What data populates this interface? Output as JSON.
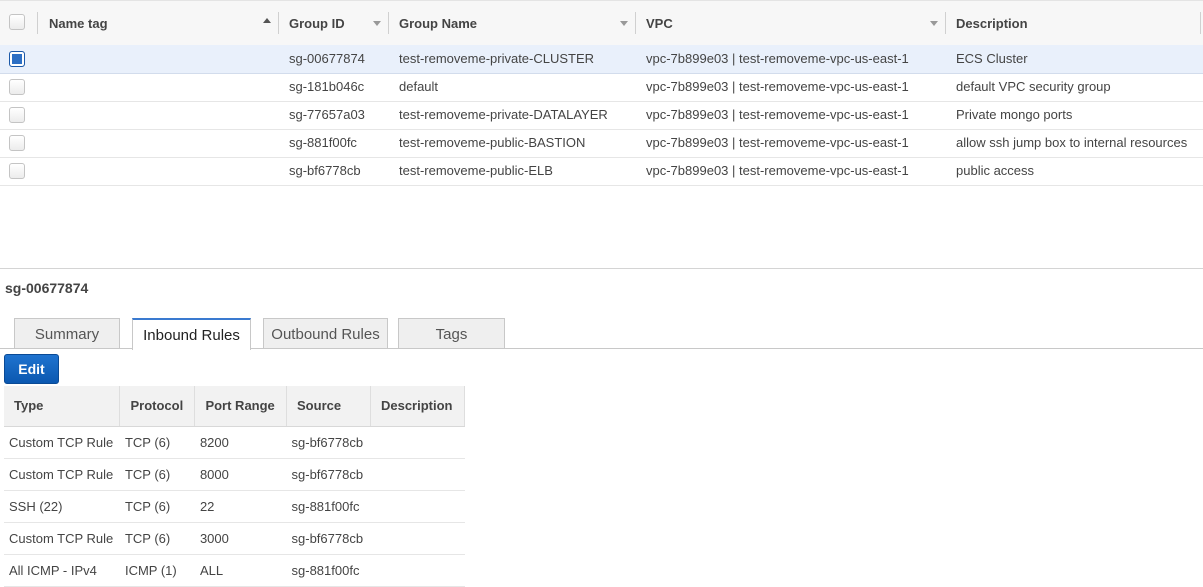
{
  "grid": {
    "columns": [
      {
        "key": "name_tag",
        "label": "Name tag"
      },
      {
        "key": "group_id",
        "label": "Group ID"
      },
      {
        "key": "group_name",
        "label": "Group Name"
      },
      {
        "key": "vpc",
        "label": "VPC"
      },
      {
        "key": "description",
        "label": "Description"
      }
    ],
    "rows": [
      {
        "selected": true,
        "name_tag": "",
        "group_id": "sg-00677874",
        "group_name": "test-removeme-private-CLUSTER",
        "vpc": "vpc-7b899e03 | test-removeme-vpc-us-east-1",
        "description": "ECS Cluster"
      },
      {
        "selected": false,
        "name_tag": "",
        "group_id": "sg-181b046c",
        "group_name": "default",
        "vpc": "vpc-7b899e03 | test-removeme-vpc-us-east-1",
        "description": "default VPC security group"
      },
      {
        "selected": false,
        "name_tag": "",
        "group_id": "sg-77657a03",
        "group_name": "test-removeme-private-DATALAYER",
        "vpc": "vpc-7b899e03 | test-removeme-vpc-us-east-1",
        "description": "Private mongo ports"
      },
      {
        "selected": false,
        "name_tag": "",
        "group_id": "sg-881f00fc",
        "group_name": "test-removeme-public-BASTION",
        "vpc": "vpc-7b899e03 | test-removeme-vpc-us-east-1",
        "description": "allow ssh jump box to internal resources"
      },
      {
        "selected": false,
        "name_tag": "",
        "group_id": "sg-bf6778cb",
        "group_name": "test-removeme-public-ELB",
        "vpc": "vpc-7b899e03 | test-removeme-vpc-us-east-1",
        "description": "public access"
      }
    ]
  },
  "detail": {
    "title": "sg-00677874",
    "tabs": [
      {
        "label": "Summary",
        "active": false
      },
      {
        "label": "Inbound Rules",
        "active": true
      },
      {
        "label": "Outbound Rules",
        "active": false
      },
      {
        "label": "Tags",
        "active": false
      }
    ],
    "edit_label": "Edit",
    "rules": {
      "headers": [
        "Type",
        "Protocol",
        "Port Range",
        "Source",
        "Description"
      ],
      "rows": [
        [
          "Custom TCP Rule",
          "TCP (6)",
          "8200",
          "sg-bf6778cb",
          ""
        ],
        [
          "Custom TCP Rule",
          "TCP (6)",
          "8000",
          "sg-bf6778cb",
          ""
        ],
        [
          "SSH (22)",
          "TCP (6)",
          "22",
          "sg-881f00fc",
          ""
        ],
        [
          "Custom TCP Rule",
          "TCP (6)",
          "3000",
          "sg-bf6778cb",
          ""
        ],
        [
          "All ICMP - IPv4",
          "ICMP (1)",
          "ALL",
          "sg-881f00fc",
          ""
        ]
      ]
    }
  },
  "colors": {
    "accent": "#2d6fc4",
    "selected_row": "#e9f0fb",
    "edit_button": "#1566c2"
  }
}
